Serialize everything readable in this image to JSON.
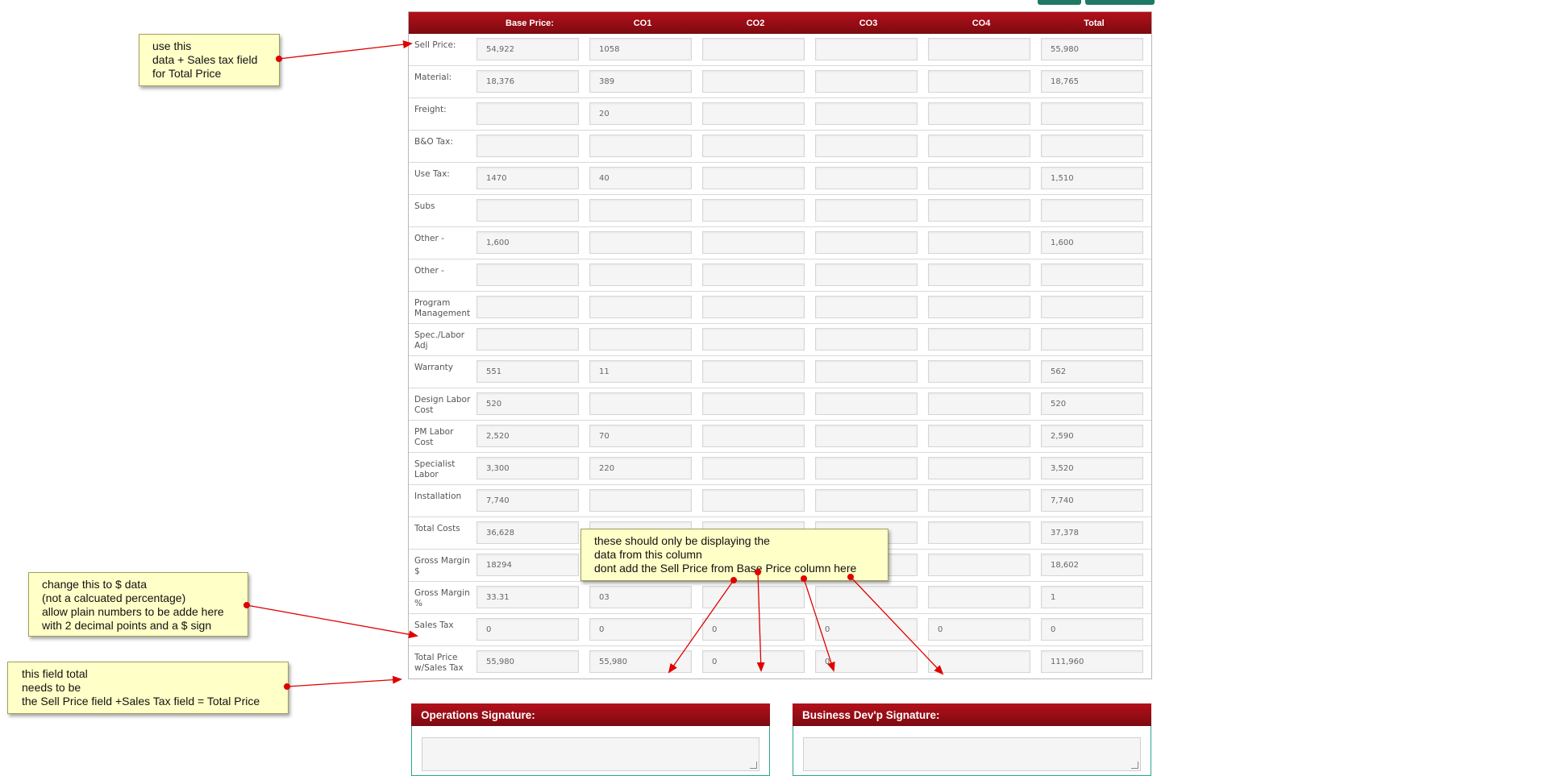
{
  "table": {
    "headers": [
      "Base Price:",
      "CO1",
      "CO2",
      "CO3",
      "CO4",
      "Total"
    ],
    "rows": [
      {
        "label": "Sell Price:",
        "values": [
          "54,922",
          "1058",
          "",
          "",
          "",
          "55,980"
        ]
      },
      {
        "label": "Material:",
        "values": [
          "18,376",
          "389",
          "",
          "",
          "",
          "18,765"
        ]
      },
      {
        "label": "Freight:",
        "values": [
          "",
          "20",
          "",
          "",
          "",
          ""
        ]
      },
      {
        "label": "B&O Tax:",
        "values": [
          "",
          "",
          "",
          "",
          "",
          ""
        ]
      },
      {
        "label": "Use Tax:",
        "values": [
          "1470",
          "40",
          "",
          "",
          "",
          "1,510"
        ]
      },
      {
        "label": "Subs",
        "values": [
          "",
          "",
          "",
          "",
          "",
          ""
        ]
      },
      {
        "label": "Other -",
        "values": [
          "1,600",
          "",
          "",
          "",
          "",
          "1,600"
        ]
      },
      {
        "label": "Other -",
        "values": [
          "",
          "",
          "",
          "",
          "",
          ""
        ]
      },
      {
        "label": "Program Management",
        "values": [
          "",
          "",
          "",
          "",
          "",
          ""
        ]
      },
      {
        "label": "Spec./Labor Adj",
        "values": [
          "",
          "",
          "",
          "",
          "",
          ""
        ]
      },
      {
        "label": "Warranty",
        "values": [
          "551",
          "11",
          "",
          "",
          "",
          "562"
        ]
      },
      {
        "label": "Design Labor Cost",
        "values": [
          "520",
          "",
          "",
          "",
          "",
          "520"
        ]
      },
      {
        "label": "PM Labor Cost",
        "values": [
          "2,520",
          "70",
          "",
          "",
          "",
          "2,590"
        ]
      },
      {
        "label": "Specialist Labor",
        "values": [
          "3,300",
          "220",
          "",
          "",
          "",
          "3,520"
        ]
      },
      {
        "label": "Installation",
        "values": [
          "7,740",
          "",
          "",
          "",
          "",
          "7,740"
        ]
      },
      {
        "label": "Total Costs",
        "values": [
          "36,628",
          "",
          "",
          "",
          "",
          "37,378"
        ]
      },
      {
        "label": "Gross Margin $",
        "values": [
          "18294",
          "",
          "",
          "",
          "",
          "18,602"
        ]
      },
      {
        "label": "Gross Margin %",
        "values": [
          "33.31",
          "03",
          "",
          "",
          "",
          "1"
        ]
      },
      {
        "label": "Sales Tax",
        "values": [
          "0",
          "0",
          "0",
          "0",
          "0",
          "0"
        ]
      },
      {
        "label": "Total Price w/Sales Tax",
        "values": [
          "55,980",
          "55,980",
          "0",
          "0",
          "",
          "111,960"
        ]
      }
    ]
  },
  "signatures": {
    "operations": "Operations Signature:",
    "business": "Business Dev'p Signature:"
  },
  "notes": {
    "sell_price": "use this\ndata + Sales tax field\nfor Total Price",
    "gross_margin": "change this to $ data\n(not a calcuated percentage)\nallow plain numbers to be adde here\nwith 2 decimal points and a $ sign",
    "total_price": "this field total\nneeds to be\nthe Sell Price field +Sales Tax field = Total Price",
    "column": "these should only be displaying the\ndata from this column\ndont add the Sell Price from Base Price column here"
  },
  "colors": {
    "header_red": "#9c0d15",
    "note_yellow": "#ffffc8",
    "arrow_red": "#e00000",
    "teal": "#1e7a66"
  }
}
